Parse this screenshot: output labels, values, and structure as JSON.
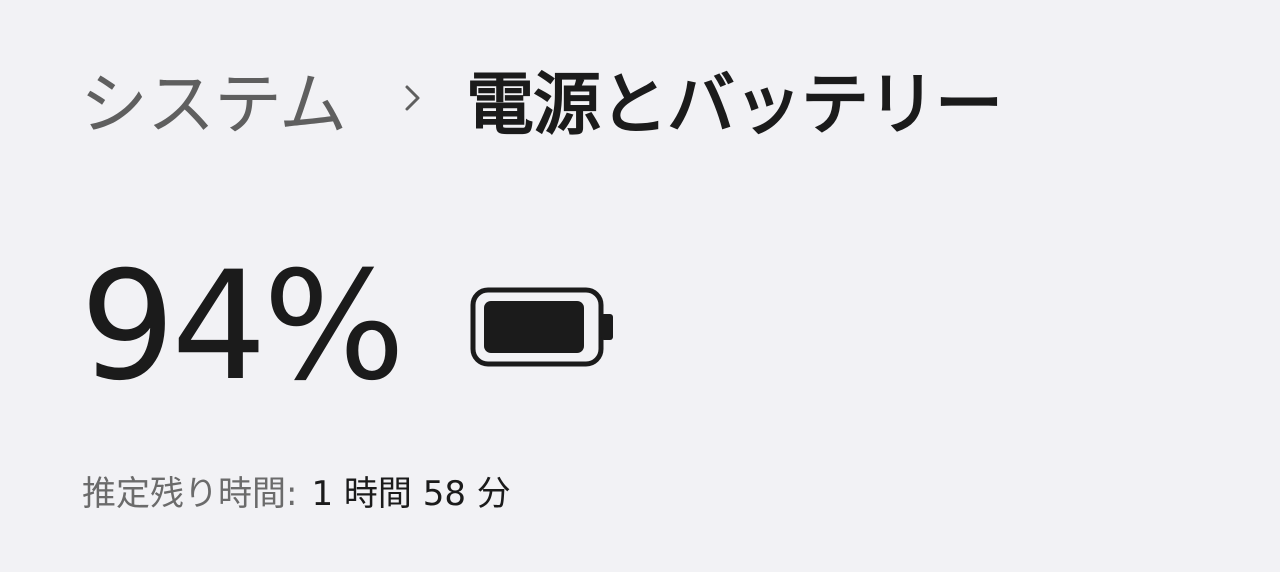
{
  "breadcrumb": {
    "parent": "システム",
    "separator_icon": "chevron-right-icon",
    "current": "電源とバッテリー"
  },
  "battery": {
    "percent_text": "94%",
    "level": 0.94,
    "icon": "battery-icon"
  },
  "estimate": {
    "label": "推定残り時間:",
    "value": "1 時間 58 分"
  },
  "colors": {
    "background": "#f2f2f5",
    "text_primary": "#1b1b1b",
    "text_secondary": "#5f5f5f"
  }
}
